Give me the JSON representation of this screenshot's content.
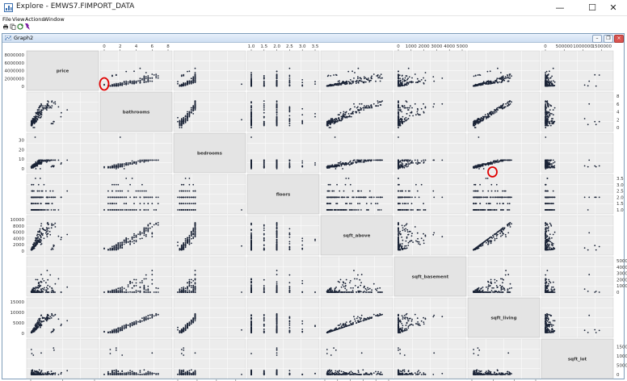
{
  "window": {
    "title": "Explore - EMWS7.FIMPORT_DATA",
    "controls": {
      "minimize": "—",
      "maximize": "☐",
      "close": "✕"
    }
  },
  "menu": [
    "File",
    "View",
    "Actions",
    "Window"
  ],
  "toolbar": [
    {
      "icon": "print-icon",
      "color": "#333333"
    },
    {
      "icon": "copy-icon",
      "color": "#555555"
    },
    {
      "icon": "refresh-icon",
      "color": "#2e7d32"
    },
    {
      "icon": "settings-icon",
      "color": "#7b1fa2"
    }
  ],
  "graph_window": {
    "title": "Graph2"
  },
  "chart_data": {
    "type": "scatter",
    "matrix_variables": [
      "price",
      "bathrooms",
      "bedrooms",
      "floors",
      "sqft_above",
      "sqft_basement",
      "sqft_living",
      "sqft_lot"
    ],
    "axes": {
      "price": {
        "range": [
          0,
          8000000
        ],
        "ticks": [
          "0",
          "4000000",
          "8000000"
        ],
        "side_ticks": [
          "0",
          "2000000",
          "4000000",
          "6000000",
          "8000000"
        ]
      },
      "bathrooms": {
        "range": [
          0,
          8
        ],
        "ticks": [
          "0",
          "2",
          "4",
          "6",
          "8"
        ]
      },
      "bedrooms": {
        "range": [
          0,
          33
        ],
        "ticks": [
          "0",
          "10",
          "20",
          "30"
        ]
      },
      "floors": {
        "range": [
          1,
          3.5
        ],
        "ticks": [
          "1.0",
          "1.5",
          "2.0",
          "2.5",
          "3.0",
          "3.5"
        ]
      },
      "sqft_above": {
        "range": [
          0,
          10000
        ],
        "ticks": [
          "0",
          "2000",
          "4000",
          "6000",
          "8000",
          "10000"
        ]
      },
      "sqft_basement": {
        "range": [
          0,
          5000
        ],
        "ticks": [
          "0",
          "1000",
          "2000",
          "3000",
          "4000",
          "5000"
        ]
      },
      "sqft_living": {
        "range": [
          0,
          15000
        ],
        "ticks": [
          "0",
          "5000",
          "10000",
          "15000"
        ]
      },
      "sqft_lot": {
        "range": [
          0,
          1700000
        ],
        "ticks": [
          "0",
          "500000",
          "1000000",
          "1500000"
        ]
      }
    },
    "annotations": [
      {
        "type": "circle",
        "row": "price",
        "col": "bathrooms",
        "note": "points at bathrooms = 0"
      },
      {
        "type": "circle",
        "row": "bedrooms",
        "col": "sqft_living",
        "note": "points at bedrooms = 0"
      }
    ],
    "colors": {
      "points": "#1a2336",
      "panel_bg": "#ececec",
      "grid": "#ffffff",
      "diag_bg": "#e4e4e4",
      "annotation": "#e00000"
    }
  }
}
